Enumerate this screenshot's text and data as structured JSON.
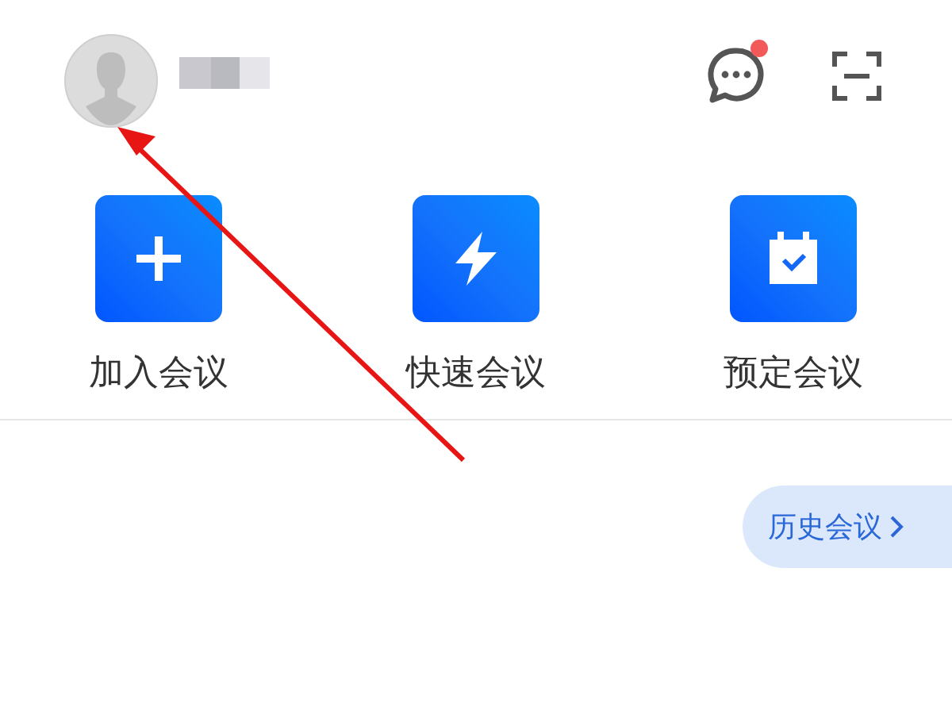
{
  "header": {
    "messages": {
      "unread": true
    }
  },
  "actions": [
    {
      "label": "加入会议",
      "kind": "join"
    },
    {
      "label": "快速会议",
      "kind": "quick"
    },
    {
      "label": "预定会议",
      "kind": "schedule"
    }
  ],
  "history_button": {
    "label": "历史会议"
  }
}
